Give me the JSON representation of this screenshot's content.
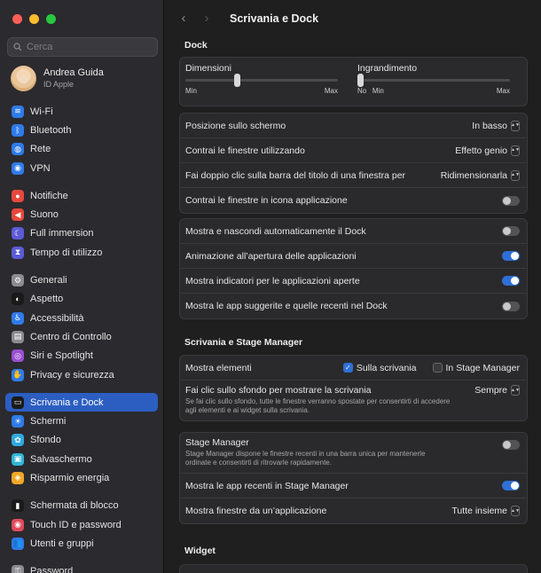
{
  "sidebar": {
    "search_placeholder": "Cerca",
    "user": {
      "name": "Andrea Guida",
      "subtitle": "ID Apple"
    },
    "items": [
      {
        "label": "Wi-Fi",
        "icon": "wifi-icon",
        "color": "#2f7bea",
        "glyph": "≋"
      },
      {
        "label": "Bluetooth",
        "icon": "bluetooth-icon",
        "color": "#2f7bea",
        "glyph": "ᛒ"
      },
      {
        "label": "Rete",
        "icon": "globe-icon",
        "color": "#2f7bea",
        "glyph": "◍"
      },
      {
        "label": "VPN",
        "icon": "vpn-icon",
        "color": "#2f7bea",
        "glyph": "◉"
      },
      {
        "label": "Notifiche",
        "icon": "bell-icon",
        "color": "#e5493d",
        "glyph": "●"
      },
      {
        "label": "Suono",
        "icon": "speaker-icon",
        "color": "#e5493d",
        "glyph": "◀"
      },
      {
        "label": "Full immersion",
        "icon": "moon-icon",
        "color": "#5b5bd6",
        "glyph": "☾"
      },
      {
        "label": "Tempo di utilizzo",
        "icon": "hourglass-icon",
        "color": "#5b5bd6",
        "glyph": "⧗"
      },
      {
        "label": "Generali",
        "icon": "gear-icon",
        "color": "#8c8c90",
        "glyph": "⚙"
      },
      {
        "label": "Aspetto",
        "icon": "appearance-icon",
        "color": "#1a1a1a",
        "glyph": "◐"
      },
      {
        "label": "Accessibilità",
        "icon": "accessibility-icon",
        "color": "#2f7bea",
        "glyph": "♿"
      },
      {
        "label": "Centro di Controllo",
        "icon": "control-center-icon",
        "color": "#8c8c90",
        "glyph": "▤"
      },
      {
        "label": "Siri e Spotlight",
        "icon": "siri-icon",
        "color": "#9a4fd0",
        "glyph": "◎"
      },
      {
        "label": "Privacy e sicurezza",
        "icon": "hand-icon",
        "color": "#2f7bea",
        "glyph": "✋"
      },
      {
        "label": "Scrivania e Dock",
        "icon": "dock-icon",
        "color": "#1a1a1a",
        "glyph": "▭",
        "active": true
      },
      {
        "label": "Schermi",
        "icon": "display-icon",
        "color": "#2f7bea",
        "glyph": "☀"
      },
      {
        "label": "Sfondo",
        "icon": "wallpaper-icon",
        "color": "#2fa9e0",
        "glyph": "✿"
      },
      {
        "label": "Salvaschermo",
        "icon": "screensaver-icon",
        "color": "#2fb6d6",
        "glyph": "▣"
      },
      {
        "label": "Risparmio energia",
        "icon": "bulb-icon",
        "color": "#f0a726",
        "glyph": "◈"
      },
      {
        "label": "Schermata di blocco",
        "icon": "lock-screen-icon",
        "color": "#1a1a1a",
        "glyph": "▮"
      },
      {
        "label": "Touch ID e password",
        "icon": "fingerprint-icon",
        "color": "#e04a5a",
        "glyph": "◉"
      },
      {
        "label": "Utenti e gruppi",
        "icon": "users-icon",
        "color": "#2f7bea",
        "glyph": "👥"
      },
      {
        "label": "Password",
        "icon": "key-icon",
        "color": "#8c8c90",
        "glyph": "⚿"
      }
    ]
  },
  "header": {
    "back": "‹",
    "forward": "›",
    "title": "Scrivania e Dock"
  },
  "dock": {
    "title": "Dock",
    "size": {
      "label": "Dimensioni",
      "min": "Min",
      "max": "Max",
      "value": 0.34
    },
    "magnification": {
      "label": "Ingrandimento",
      "no": "No",
      "min": "Min",
      "max": "Max",
      "value": 0.0
    },
    "position": {
      "label": "Posizione sullo schermo",
      "value": "In basso"
    },
    "minimize": {
      "label": "Contrai le finestre utilizzando",
      "value": "Effetto genio"
    },
    "double_click": {
      "label": "Fai doppio clic sulla barra del titolo di una finestra per",
      "value": "Ridimensionarla"
    },
    "minimize_into_icon": {
      "label": "Contrai le finestre in icona applicazione",
      "on": false
    },
    "autohide": {
      "label": "Mostra e nascondi automaticamente il Dock",
      "on": false
    },
    "animate": {
      "label": "Animazione all’apertura delle applicazioni",
      "on": true
    },
    "indicators": {
      "label": "Mostra indicatori per le applicazioni aperte",
      "on": true
    },
    "suggested": {
      "label": "Mostra le app suggerite e quelle recenti nel Dock",
      "on": false
    }
  },
  "desktop": {
    "title": "Scrivania e Stage Manager",
    "show_items": {
      "label": "Mostra elementi",
      "opt1": "Sulla scrivania",
      "opt1_on": true,
      "opt2": "In Stage Manager",
      "opt2_on": false
    },
    "click_wallpaper": {
      "label": "Fai clic sullo sfondo per mostrare la scrivania",
      "desc": "Se fai clic sullo sfondo, tutte le finestre verranno spostate per consentirti di accedere agli elementi e ai widget sulla scrivania.",
      "value": "Sempre"
    },
    "stage_manager": {
      "label": "Stage Manager",
      "desc": "Stage Manager dispone le finestre recenti in una barra unica per mantenerle ordinate e consentirti di ritrovarle rapidamente.",
      "on": false
    },
    "recent_apps": {
      "label": "Mostra le app recenti in Stage Manager",
      "on": true
    },
    "show_windows": {
      "label": "Mostra finestre da un’applicazione",
      "value": "Tutte insieme"
    }
  },
  "widget": {
    "title": "Widget"
  }
}
